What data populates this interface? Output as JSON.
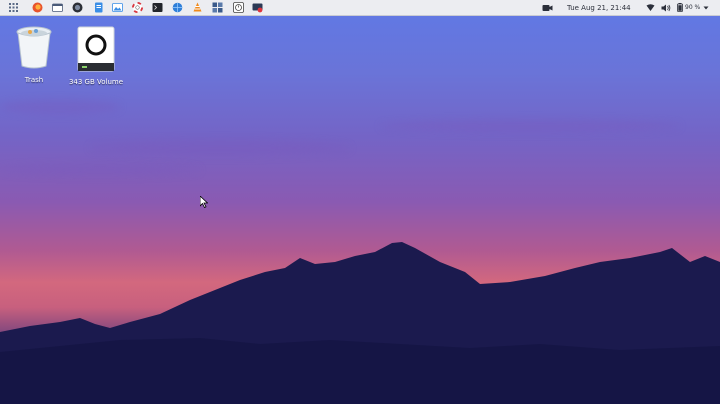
{
  "topbar": {
    "apps": [
      {
        "icon": "app-grid-icon"
      },
      {
        "icon": "firefox-icon"
      },
      {
        "icon": "files-icon"
      },
      {
        "icon": "camera-app-icon"
      },
      {
        "icon": "document-icon"
      },
      {
        "icon": "image-viewer-icon"
      },
      {
        "icon": "lifebuoy-icon"
      },
      {
        "icon": "terminal-icon"
      },
      {
        "icon": "browser-icon"
      },
      {
        "icon": "vlc-icon"
      },
      {
        "icon": "window-grid-icon"
      },
      {
        "icon": "clock-icon"
      },
      {
        "icon": "screen-recorder-icon"
      }
    ],
    "clock": "Tue Aug 21, 21:44",
    "battery": "90 %"
  },
  "desktop": {
    "icons": [
      {
        "label": "Trash",
        "icon": "trash-icon"
      },
      {
        "label": "343 GB Volume",
        "icon": "drive-icon"
      }
    ]
  },
  "colors": {
    "sky_top": "#5f79e6",
    "sky_mid": "#8a5ab2",
    "horizon": "#d3687e",
    "mountains": "#1b1a4e",
    "panel": "#ecedf1"
  }
}
